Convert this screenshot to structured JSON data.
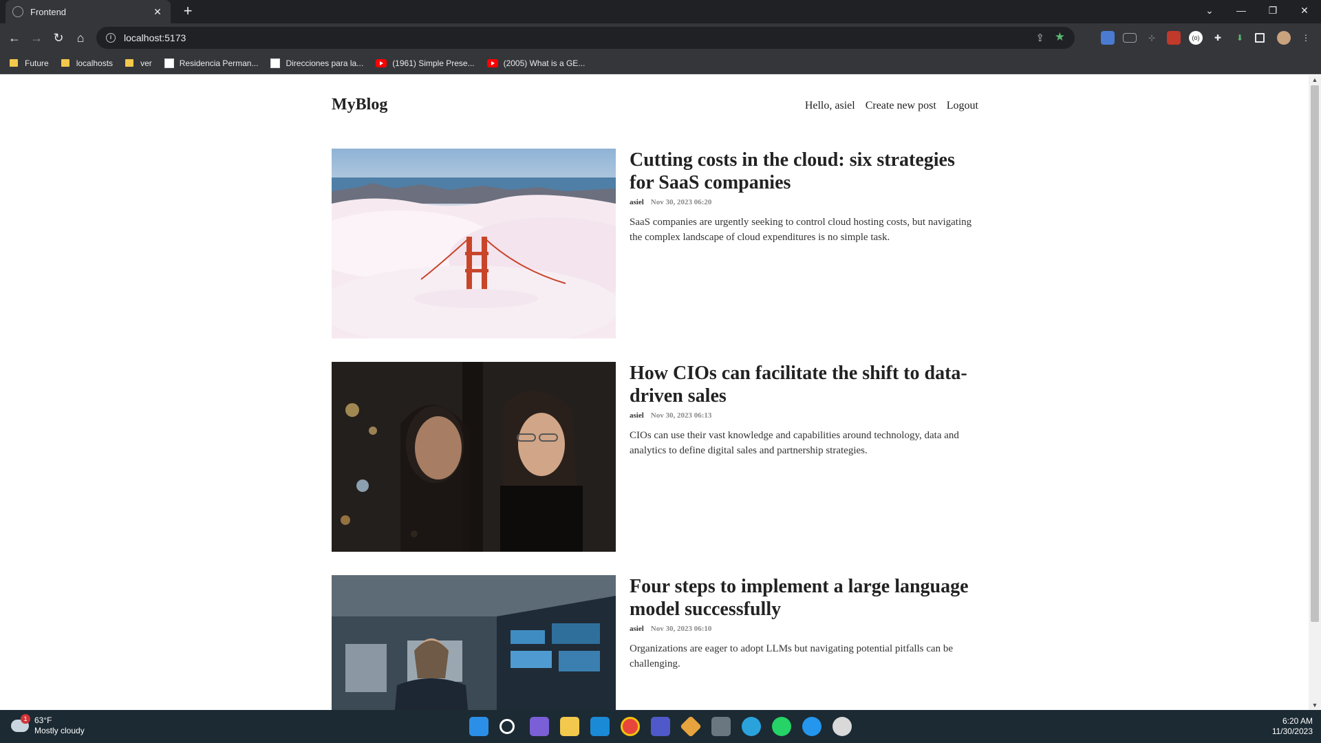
{
  "browser": {
    "tab_title": "Frontend",
    "tab_close": "✕",
    "new_tab": "+",
    "url": "localhost:5173",
    "window_controls": {
      "collapse": "⌄",
      "minimize": "—",
      "restore": "❐",
      "close": "✕"
    },
    "nav": {
      "back": "←",
      "forward": "→",
      "reload": "↻",
      "home": "⌂"
    },
    "bookmarks": [
      {
        "label": "Future",
        "icon": "folder-icon"
      },
      {
        "label": "localhosts",
        "icon": "folder-icon"
      },
      {
        "label": "ver",
        "icon": "folder-icon"
      },
      {
        "label": "Residencia Perman...",
        "icon": "doc-icon"
      },
      {
        "label": "Direcciones para la...",
        "icon": "doc-icon"
      },
      {
        "label": "(1961) Simple Prese...",
        "icon": "youtube-icon"
      },
      {
        "label": "(2005) What is a GE...",
        "icon": "youtube-icon"
      }
    ]
  },
  "site": {
    "logo": "MyBlog",
    "nav": {
      "greeting": "Hello, asiel",
      "create": "Create new post",
      "logout": "Logout"
    }
  },
  "posts": [
    {
      "title": "Cutting costs in the cloud: six strategies for SaaS companies",
      "author": "asiel",
      "time": "Nov 30, 2023 06:20",
      "summary": "SaaS companies are urgently seeking to control cloud hosting costs, but navigating the complex landscape of cloud expenditures is no simple task.",
      "image": "golden-gate-bridge-in-fog"
    },
    {
      "title": "How CIOs can facilitate the shift to data-driven sales",
      "author": "asiel",
      "time": "Nov 30, 2023 06:13",
      "summary": "CIOs can use their vast knowledge and capabilities around technology, data and analytics to define digital sales and partnership strategies.",
      "image": "woman-reflection-in-window"
    },
    {
      "title": "Four steps to implement a large language model successfully",
      "author": "asiel",
      "time": "Nov 30, 2023 06:10",
      "summary": "Organizations are eager to adopt LLMs but navigating potential pitfalls can be challenging.",
      "image": "woman-at-computer-monitors"
    }
  ],
  "taskbar": {
    "weather_temp": "63°F",
    "weather_desc": "Mostly cloudy",
    "weather_badge": "1",
    "time": "6:20 AM",
    "date": "11/30/2023"
  },
  "colors": {
    "chrome_dark": "#202124",
    "chrome_toolbar": "#35363a",
    "taskbar": "#1c2a33"
  }
}
